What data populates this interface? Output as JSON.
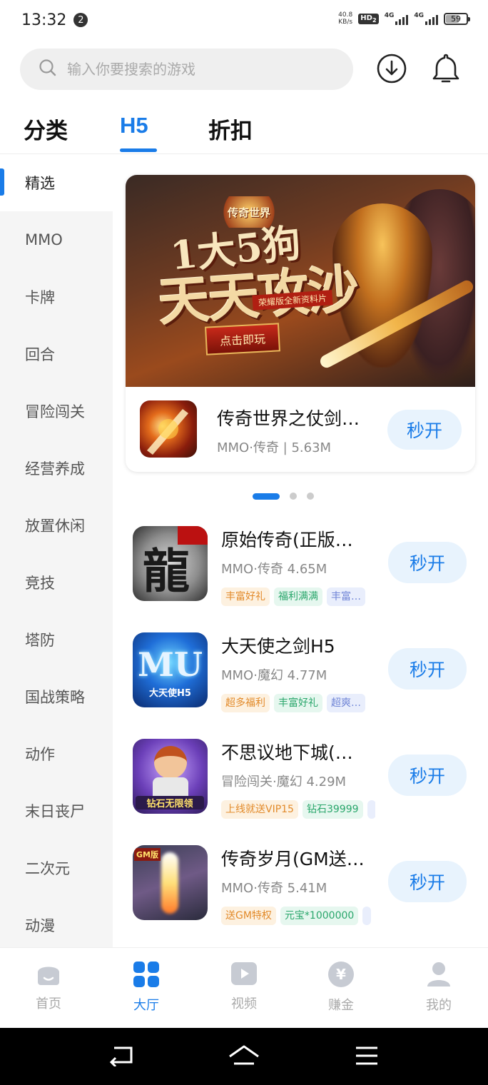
{
  "status_bar": {
    "time": "13:32",
    "notification_count": "2",
    "net_speed_value": "40.8",
    "net_speed_unit": "KB/s",
    "hd_label": "HD",
    "hd_sub": "2",
    "sim1_label": "4G",
    "sim2_label": "4G",
    "battery": "59"
  },
  "search": {
    "placeholder": "输入你要搜索的游戏"
  },
  "header_icons": [
    "download-icon",
    "bell-icon"
  ],
  "tabs": [
    {
      "label": "分类",
      "active": false
    },
    {
      "label": "H5",
      "active": true
    },
    {
      "label": "折扣",
      "active": false
    }
  ],
  "sidebar": {
    "items": [
      {
        "label": "精选",
        "active": true
      },
      {
        "label": "MMO"
      },
      {
        "label": "卡牌"
      },
      {
        "label": "回合"
      },
      {
        "label": "冒险闯关"
      },
      {
        "label": "经营养成"
      },
      {
        "label": "放置休闲"
      },
      {
        "label": "竞技"
      },
      {
        "label": "塔防"
      },
      {
        "label": "国战策略"
      },
      {
        "label": "动作"
      },
      {
        "label": "末日丧尸"
      },
      {
        "label": "二次元"
      },
      {
        "label": "动漫"
      }
    ]
  },
  "featured": {
    "banner": {
      "logo_text": "传奇世界",
      "headline_top": "1大5狗",
      "headline": "天天攻沙",
      "tagline": "荣耀版全新资料片",
      "play_label": "点击即玩"
    },
    "name": "传奇世界之仗剑…",
    "meta": "MMO·传奇 | 5.63M",
    "button": "秒开"
  },
  "carousel": {
    "count": 3,
    "active": 0
  },
  "games": [
    {
      "name": "原始传奇(正版…",
      "meta": "MMO·传奇  4.65M",
      "tags": [
        {
          "text": "丰富好礼",
          "color": "orange"
        },
        {
          "text": "福利满满",
          "color": "green"
        },
        {
          "text": "丰富…",
          "color": "blue"
        }
      ],
      "button": "秒开",
      "icon_text": "龍"
    },
    {
      "name": "大天使之剑H5",
      "meta": "MMO·魔幻  4.77M",
      "tags": [
        {
          "text": "超多福利",
          "color": "orange"
        },
        {
          "text": "丰富好礼",
          "color": "green"
        },
        {
          "text": "超爽…",
          "color": "blue"
        }
      ],
      "button": "秒开",
      "icon_text": "MU"
    },
    {
      "name": "不思议地下城(…",
      "meta": "冒险闯关·魔幻  4.29M",
      "tags": [
        {
          "text": "上线就送VIP15",
          "color": "orange"
        },
        {
          "text": "钻石39999",
          "color": "green"
        },
        {
          "text": "",
          "color": "blue"
        }
      ],
      "button": "秒开",
      "icon_text": "钻石无限领"
    },
    {
      "name": "传奇岁月(GM送…",
      "meta": "MMO·传奇  5.41M",
      "tags": [
        {
          "text": "送GM特权",
          "color": "orange"
        },
        {
          "text": "元宝*1000000",
          "color": "green"
        },
        {
          "text": "",
          "color": "blue"
        }
      ],
      "button": "秒开",
      "icon_text": "GM版"
    }
  ],
  "bottom_nav": [
    {
      "label": "首页",
      "icon": "home-icon",
      "active": false
    },
    {
      "label": "大厅",
      "icon": "grid-icon",
      "active": true
    },
    {
      "label": "视频",
      "icon": "video-icon",
      "active": false
    },
    {
      "label": "赚金",
      "icon": "coin-icon",
      "active": false
    },
    {
      "label": "我的",
      "icon": "user-icon",
      "active": false
    }
  ],
  "colors": {
    "accent": "#1a7ce8",
    "sidebar_bg": "#f5f5f5",
    "tag_orange": "#e28a2a",
    "tag_green": "#29a66b",
    "tag_blue": "#6f84d6"
  }
}
